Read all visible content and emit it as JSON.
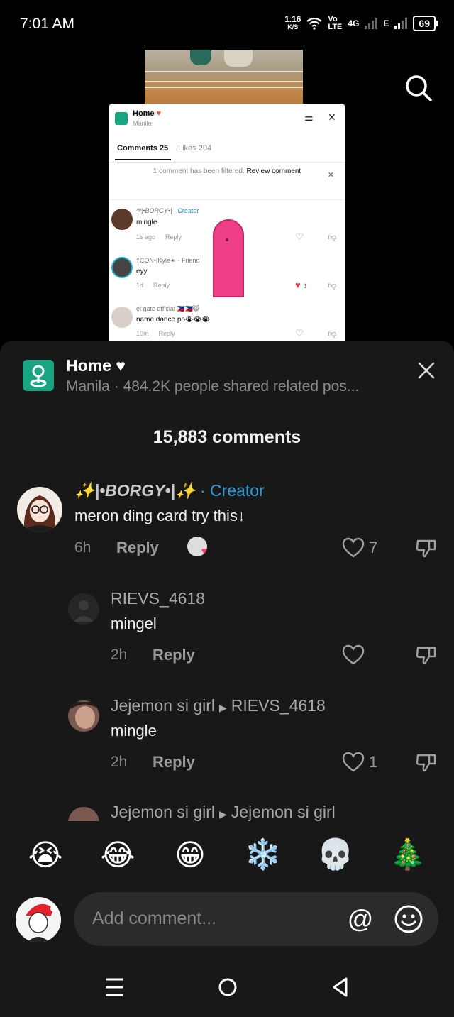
{
  "status_bar": {
    "time": "7:01 AM",
    "speed_value": "1.16",
    "speed_unit": "K/S",
    "volte_top": "Vo",
    "volte_bottom": "LTE",
    "network_4g": "4G",
    "network_e": "E",
    "battery": "69"
  },
  "embedded_preview": {
    "title": "Home",
    "subtitle": "Manila",
    "tabs": [
      "Comments 25",
      "Likes 204"
    ],
    "filter_notice": "1 comment has been filtered.",
    "filter_action": "Review comment",
    "comments": [
      {
        "user": "ᵈᵖ|•BORGY•|",
        "badge": "· Creator",
        "text": "mingle",
        "time": "1s ago",
        "reply": "Reply"
      },
      {
        "user": "☨CON•|Kyle☙ · Friend",
        "badge": "",
        "text": "eyy",
        "time": "1d",
        "reply": "Reply",
        "likes": "1"
      },
      {
        "user": "el gato official 🇵🇭🇵🇭😺",
        "badge": "",
        "text": "name dance po😭😭😭",
        "time": "10m",
        "reply": "Reply"
      }
    ]
  },
  "sheet": {
    "title": "Home ♥",
    "subtitle": "Manila · 484.2K people shared related pos...",
    "comment_count": "15,883 comments"
  },
  "comments": [
    {
      "user": "✨|•BORGY•|✨",
      "badge": " · Creator",
      "text": "meron ding card try this↓",
      "time": "6h",
      "reply": "Reply",
      "likes": "7"
    },
    {
      "user": "RIEVS_4618",
      "reply_to": "",
      "text": "mingel",
      "time": "2h",
      "reply": "Reply",
      "likes": ""
    },
    {
      "user": "Jejemon si girl",
      "reply_to": "RIEVS_4618",
      "text": "mingle",
      "time": "2h",
      "reply": "Reply",
      "likes": "1"
    },
    {
      "user": "Jejemon si girl",
      "reply_to": "Jejemon si girl"
    }
  ],
  "emoji_bar": [
    "😭",
    "😂",
    "😁",
    "❄️",
    "💀",
    "🎄"
  ],
  "composer": {
    "placeholder": "Add comment...",
    "at_symbol": "@"
  }
}
